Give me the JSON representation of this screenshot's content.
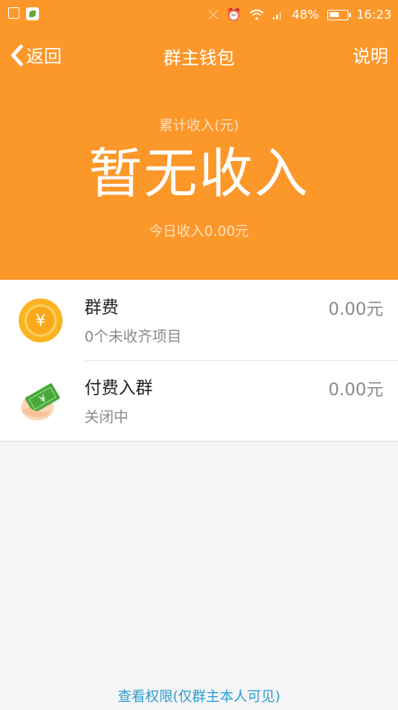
{
  "status_bar": {
    "battery": "48%",
    "time": "16:23"
  },
  "nav": {
    "back_label": "返回",
    "title": "群主钱包",
    "help_label": "说明"
  },
  "summary": {
    "label": "累计收入(元)",
    "value": "暂无收入",
    "today": "今日收入0.00元"
  },
  "rows": [
    {
      "title": "群费",
      "subtitle": "0个未收齐项目",
      "amount": "0.00元",
      "icon": "yuan-coin-icon"
    },
    {
      "title": "付费入群",
      "subtitle": "关闭中",
      "amount": "0.00元",
      "icon": "hand-money-icon"
    }
  ],
  "footer": {
    "link": "查看权限(仅群主本人可见)"
  },
  "colors": {
    "header_orange": "#fc972a",
    "coin_yellow": "#fbb321",
    "money_green": "#48a93b",
    "link_blue": "#2a9fd0"
  }
}
